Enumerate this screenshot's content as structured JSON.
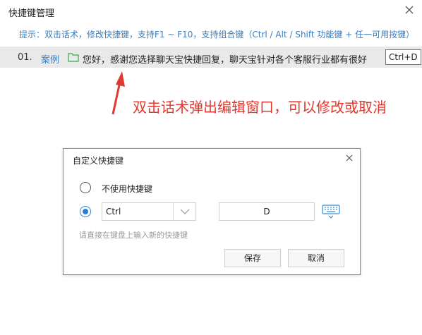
{
  "window": {
    "title": "快捷键管理"
  },
  "tip": "提示：双击话术，修改快捷键，支持F1 ~ F10，支持组合键（Ctrl / Alt / Shift 功能键 + 任一可用按键）",
  "row": {
    "number": "01.",
    "category": "案例",
    "text": "您好，感谢您选择聊天宝快捷回复，聊天宝针对各个客服行业都有很好",
    "shortcut": "Ctrl+D"
  },
  "annotation": "双击话术弹出编辑窗口，可以修改或取消",
  "colors": {
    "accent": "#3a7fc1",
    "annotation": "#e03a30",
    "radio_selected": "#2b7fd6"
  },
  "dialog": {
    "title": "自定义快捷键",
    "option_none": "不使用快捷键",
    "modifier": "Ctrl",
    "key": "D",
    "hint": "请直接在键盘上输入新的快捷键",
    "save": "保存",
    "cancel": "取消"
  }
}
